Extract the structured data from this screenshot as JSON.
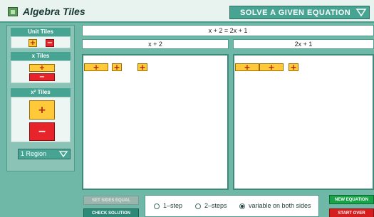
{
  "app": {
    "title": "Algebra Tiles",
    "mode": "SOLVE A GIVEN EQUATION"
  },
  "sidebar": {
    "unit_tiles_label": "Unit Tiles",
    "x_tiles_label": "x Tiles",
    "x2_tiles_label": "x² Tiles",
    "plus": "+",
    "minus": "−",
    "region_value": "1 Region"
  },
  "equation": {
    "text": "x + 2 = 2x + 1",
    "left_side": "x + 2",
    "right_side": "2x + 1"
  },
  "workspace": {
    "left_tiles": [
      "+",
      "+",
      "+"
    ],
    "right_tiles": [
      "+",
      "+",
      "+"
    ]
  },
  "buttons": {
    "set_sides_equal": "SET SIDES EQUAL",
    "check_solution": "CHECK SOLUTION",
    "new_equation": "NEW EQUATION",
    "start_over": "START OVER"
  },
  "options": {
    "one_step": "1–step",
    "two_steps": "2–steps",
    "variable_both_sides": "variable on both sides",
    "selected": "variable on both sides"
  },
  "colors": {
    "background": "#6fb8a8",
    "accent": "#47a493",
    "positive_tile": "#ffc93a",
    "negative_tile": "#e8242b"
  }
}
